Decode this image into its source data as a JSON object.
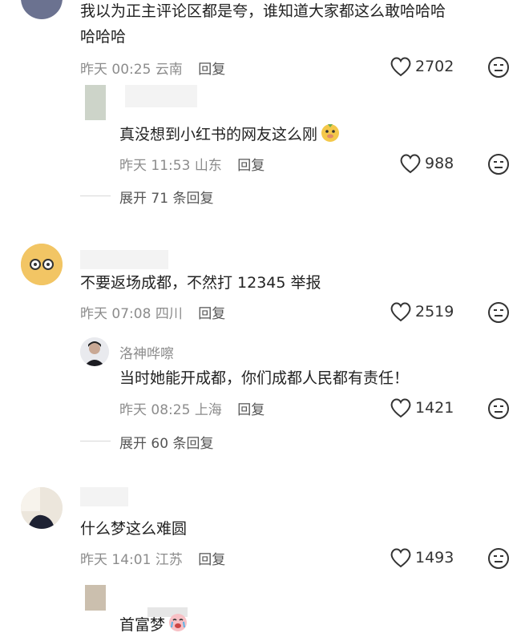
{
  "comments": [
    {
      "text": "我以为正主评论区都是夸，谁知道大家都这么敢哈哈哈",
      "text_line2": "哈哈哈",
      "time": "昨天 00:25",
      "location": "云南",
      "reply_label": "回复",
      "likes": "2702",
      "reply": {
        "username": "",
        "text": "真没想到小红书的网友这么刚",
        "emoji": "doge-emoji-icon",
        "time": "昨天 11:53",
        "location": "山东",
        "reply_label": "回复",
        "likes": "988"
      },
      "expand_label": "展开 71 条回复"
    },
    {
      "text": "不要返场成都，不然打 12345 举报",
      "time": "昨天 07:08",
      "location": "四川",
      "reply_label": "回复",
      "likes": "2519",
      "reply": {
        "username": "洛神哗嚓",
        "text": "当时她能开成都，你们成都人民都有责任！",
        "time": "昨天 08:25",
        "location": "上海",
        "reply_label": "回复",
        "likes": "1421"
      },
      "expand_label": "展开 60 条回复"
    },
    {
      "text": "什么梦这么难圆",
      "time": "昨天 14:01",
      "location": "江苏",
      "reply_label": "回复",
      "likes": "1493",
      "reply": {
        "username": "",
        "text": "首富梦",
        "emoji": "crying-emoji-icon"
      }
    }
  ],
  "colors": {
    "meta_gray": "#8c8c8c",
    "text": "#222222",
    "divider": "#d8d8d8"
  }
}
